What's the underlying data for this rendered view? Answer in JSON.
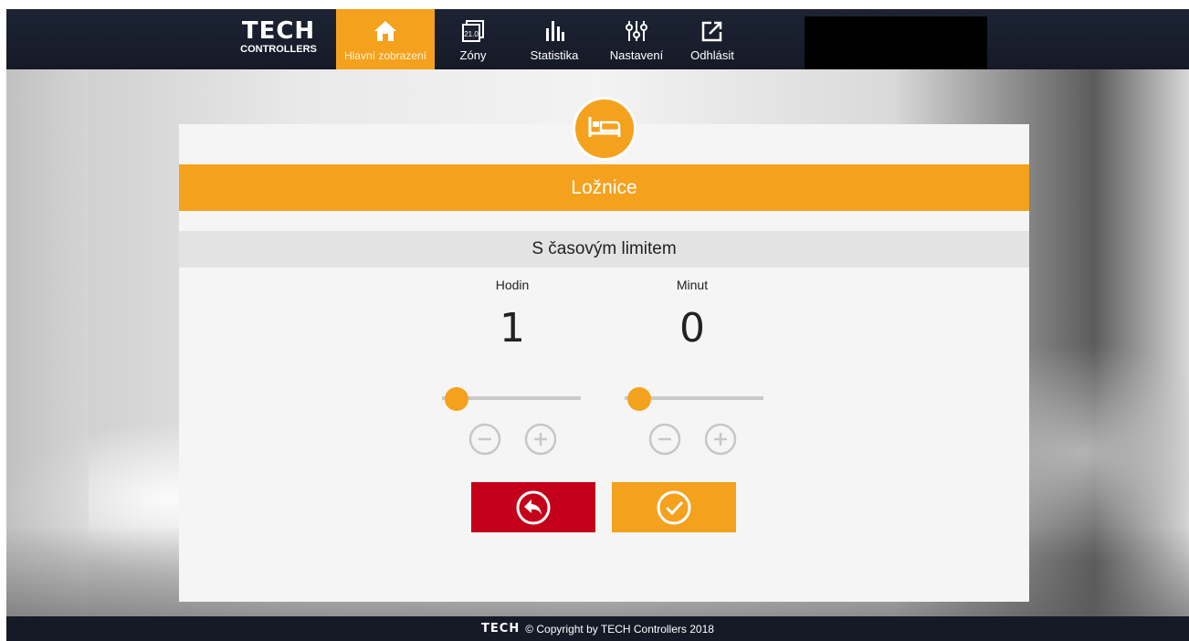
{
  "header": {
    "logo": {
      "mark": "TECH",
      "sub": "CONTROLLERS"
    },
    "nav": [
      {
        "label": "Hlavní zobrazení",
        "icon": "home-icon",
        "active": true
      },
      {
        "label": "Zóny",
        "icon": "zones-icon",
        "icon_text": "21.0"
      },
      {
        "label": "Statistika",
        "icon": "statistics-icon"
      },
      {
        "label": "Nastavení",
        "icon": "settings-sliders-icon"
      },
      {
        "label": "Odhlásit",
        "icon": "logout-icon"
      }
    ]
  },
  "zone": {
    "name": "Ložnice",
    "icon": "bed-icon"
  },
  "mode": {
    "title": "S časovým limitem"
  },
  "timer": {
    "hours": {
      "label": "Hodin",
      "value": "1"
    },
    "minutes": {
      "label": "Minut",
      "value": "0"
    }
  },
  "buttons": {
    "back": {
      "icon": "back-arrow-icon"
    },
    "confirm": {
      "icon": "checkmark-icon"
    }
  },
  "footer": {
    "mark": "TECH",
    "text": "© Copyright by TECH Controllers 2018"
  },
  "colors": {
    "accent": "#f4a11e",
    "danger": "#c4001a",
    "header": "#1c2333"
  }
}
